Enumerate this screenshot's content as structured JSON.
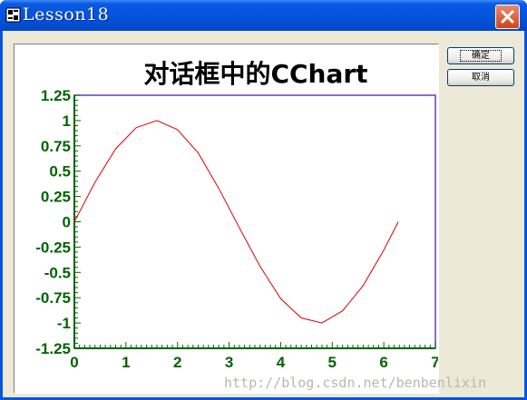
{
  "window": {
    "title": "Lesson18",
    "close_label": "Close"
  },
  "buttons": {
    "ok_label": "确定",
    "cancel_label": "取消"
  },
  "chart_data": {
    "type": "line",
    "title": "对话框中的CChart",
    "xlim": [
      0,
      7
    ],
    "ylim": [
      -1.25,
      1.25
    ],
    "x_ticks": [
      "0",
      "1",
      "2",
      "3",
      "4",
      "5",
      "6",
      "7"
    ],
    "y_ticks": [
      "1.25",
      "1",
      "0.75",
      "0.5",
      "0.25",
      "0",
      "-0.25",
      "-0.5",
      "-0.75",
      "-1",
      "-1.25"
    ],
    "grid": false,
    "series": [
      {
        "color": "#dd0000",
        "x": [
          0,
          0.4,
          0.8,
          1.2,
          1.6,
          2.0,
          2.4,
          2.8,
          3.2,
          3.6,
          4.0,
          4.4,
          4.8,
          5.2,
          5.6,
          6.0,
          6.28
        ],
        "y": [
          0,
          0.39,
          0.72,
          0.93,
          1.0,
          0.91,
          0.68,
          0.33,
          -0.06,
          -0.44,
          -0.76,
          -0.95,
          -1.0,
          -0.88,
          -0.63,
          -0.28,
          0
        ]
      }
    ],
    "tick_color": "#006400",
    "axis_color": "#6a39b8",
    "title_color": "#000000"
  },
  "watermark": "http://blog.csdn.net/benbenlixin"
}
